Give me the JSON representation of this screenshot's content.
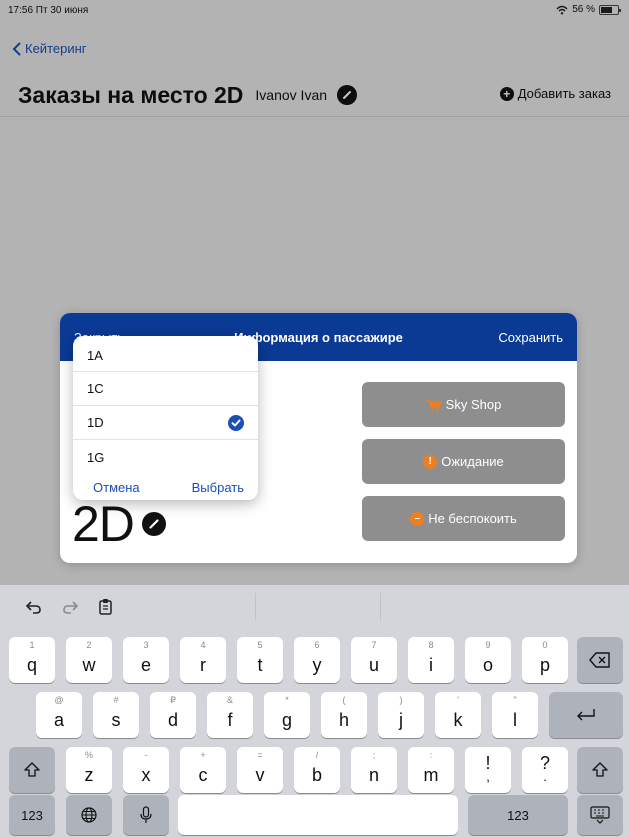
{
  "status_bar": {
    "time": "17:56 Пт 30 июня",
    "battery": "56 %"
  },
  "nav": {
    "back_label": "Кейтеринг"
  },
  "header": {
    "title": "Заказы на место 2D",
    "user": "Ivanov Ivan",
    "add_order": "Добавить заказ"
  },
  "modal": {
    "close_label": "Закрыть",
    "title": "Информация о пассажире",
    "save_label": "Сохранить",
    "seat": "2D",
    "actions": [
      {
        "label": "Sky Shop",
        "icon": "cart-icon"
      },
      {
        "label": "Ожидание",
        "icon": "clock-icon"
      },
      {
        "label": "Не беспокоить",
        "icon": "do-not-disturb-icon"
      }
    ]
  },
  "picker": {
    "options": [
      "1A",
      "1C",
      "1D",
      "1G"
    ],
    "selected": "1D",
    "cancel_label": "Отмена",
    "select_label": "Выбрать"
  },
  "keyboard": {
    "row1": [
      {
        "hint": "1",
        "key": "q"
      },
      {
        "hint": "2",
        "key": "w"
      },
      {
        "hint": "3",
        "key": "e"
      },
      {
        "hint": "4",
        "key": "r"
      },
      {
        "hint": "5",
        "key": "t"
      },
      {
        "hint": "6",
        "key": "y"
      },
      {
        "hint": "7",
        "key": "u"
      },
      {
        "hint": "8",
        "key": "i"
      },
      {
        "hint": "9",
        "key": "o"
      },
      {
        "hint": "0",
        "key": "p"
      }
    ],
    "row2": [
      {
        "hint": "@",
        "key": "a"
      },
      {
        "hint": "#",
        "key": "s"
      },
      {
        "hint": "₽",
        "key": "d"
      },
      {
        "hint": "&",
        "key": "f"
      },
      {
        "hint": "*",
        "key": "g"
      },
      {
        "hint": "(",
        "key": "h"
      },
      {
        "hint": ")",
        "key": "j"
      },
      {
        "hint": "'",
        "key": "k"
      },
      {
        "hint": "\"",
        "key": "l"
      }
    ],
    "row3": [
      {
        "hint": "%",
        "key": "z"
      },
      {
        "hint": "-",
        "key": "x"
      },
      {
        "hint": "+",
        "key": "c"
      },
      {
        "hint": "=",
        "key": "v"
      },
      {
        "hint": "/",
        "key": "b"
      },
      {
        "hint": ";",
        "key": "n"
      },
      {
        "hint": ":",
        "key": "m"
      },
      {
        "hint": "",
        "key": "!"
      },
      {
        "hint": "",
        "key": "?"
      }
    ],
    "row3_under": [
      "",
      "",
      "",
      "",
      "",
      "",
      "",
      ",",
      "."
    ],
    "num_label": "123"
  }
}
